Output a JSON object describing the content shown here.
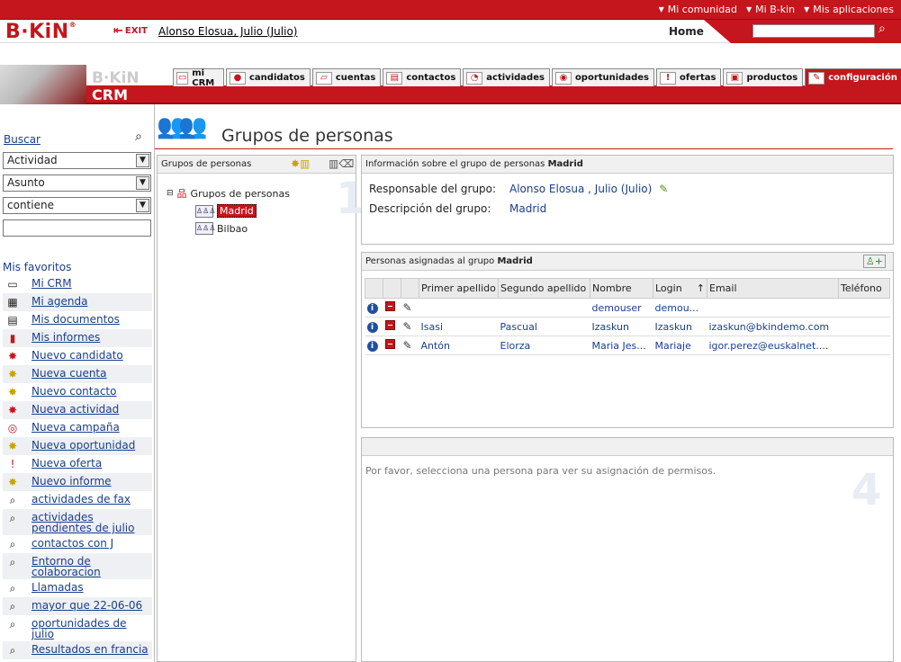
{
  "topbar": {
    "links": [
      "Mi comunidad",
      "Mi B-kin",
      "Mis aplicaciones"
    ]
  },
  "header": {
    "logo": "B·KiN",
    "logo_mark": "®",
    "exit_label": "EXIT",
    "user": "Alonso Elosua, Julio (Julio)",
    "home": "Home"
  },
  "banner": {
    "brand": "B·KiN",
    "product": "CRM"
  },
  "tabs": [
    {
      "label": "mi CRM",
      "icon": "monitor-icon"
    },
    {
      "label": "candidatos",
      "icon": "person-icon"
    },
    {
      "label": "cuentas",
      "icon": "folder-icon"
    },
    {
      "label": "contactos",
      "icon": "card-icon"
    },
    {
      "label": "actividades",
      "icon": "clock-icon"
    },
    {
      "label": "oportunidades",
      "icon": "coins-icon"
    },
    {
      "label": "ofertas",
      "icon": "exclamation-icon"
    },
    {
      "label": "productos",
      "icon": "box-icon"
    },
    {
      "label": "configuración",
      "icon": "wrench-icon",
      "active": true
    }
  ],
  "sidebar": {
    "buscar": "Buscar",
    "selects": [
      "Actividad",
      "Asunto",
      "contiene"
    ],
    "favorites_title": "Mis favoritos",
    "favorites": [
      {
        "label": "Mi CRM",
        "icon": "monitor-icon"
      },
      {
        "label": "Mi agenda",
        "icon": "calendar-icon"
      },
      {
        "label": "Mis documentos",
        "icon": "document-icon"
      },
      {
        "label": "Mis informes",
        "icon": "chart-icon"
      },
      {
        "label": "Nuevo candidato",
        "icon": "new-person-icon"
      },
      {
        "label": "Nueva cuenta",
        "icon": "new-folder-icon"
      },
      {
        "label": "Nuevo contacto",
        "icon": "new-card-icon"
      },
      {
        "label": "Nueva actividad",
        "icon": "new-clock-icon"
      },
      {
        "label": "Nueva campaña",
        "icon": "target-icon"
      },
      {
        "label": "Nueva oportunidad",
        "icon": "new-coins-icon"
      },
      {
        "label": "Nueva oferta",
        "icon": "new-exclamation-icon"
      },
      {
        "label": "Nuevo informe",
        "icon": "new-chart-icon"
      },
      {
        "label": "actividades de fax",
        "icon": "search-icon"
      },
      {
        "label": "actividades pendientes de julio",
        "icon": "search-icon"
      },
      {
        "label": "contactos con J",
        "icon": "search-icon"
      },
      {
        "label": "Entorno de colaboracion",
        "icon": "search-icon"
      },
      {
        "label": "Llamadas",
        "icon": "search-icon"
      },
      {
        "label": "mayor que 22-06-06",
        "icon": "search-icon"
      },
      {
        "label": "oportunidades de julio",
        "icon": "search-icon"
      },
      {
        "label": "Resultados en francia",
        "icon": "search-icon"
      }
    ]
  },
  "page": {
    "title": "Grupos de personas"
  },
  "tree": {
    "header": "Grupos de personas",
    "root": "Grupos de personas",
    "nodes": [
      "Madrid",
      "Bilbao"
    ],
    "number": "1"
  },
  "info": {
    "header_prefix": "Información sobre el grupo de personas",
    "header_group": "Madrid",
    "responsable_label": "Responsable del grupo:",
    "responsable_value": "Alonso Elosua , Julio (Julio)",
    "descripcion_label": "Descripción del grupo:",
    "descripcion_value": "Madrid"
  },
  "people": {
    "header_prefix": "Personas asignadas al grupo",
    "header_group": "Madrid",
    "columns": [
      "Primer apellido",
      "Segundo apellido",
      "Nombre",
      "Login",
      "Email",
      "Teléfono"
    ],
    "rows": [
      [
        "",
        "",
        "demouser",
        "demou...",
        "",
        ""
      ],
      [
        "Isasi",
        "Pascual",
        "Izaskun",
        "Izaskun",
        "izaskun@bkindemo.com",
        ""
      ],
      [
        "Antón",
        "Elorza",
        "Maria Jes...",
        "Mariaje",
        "igor.perez@euskalnet....",
        ""
      ]
    ]
  },
  "permissions": {
    "message": "Por favor, selecciona una persona para ver su asignación de permisos.",
    "number": "4"
  }
}
